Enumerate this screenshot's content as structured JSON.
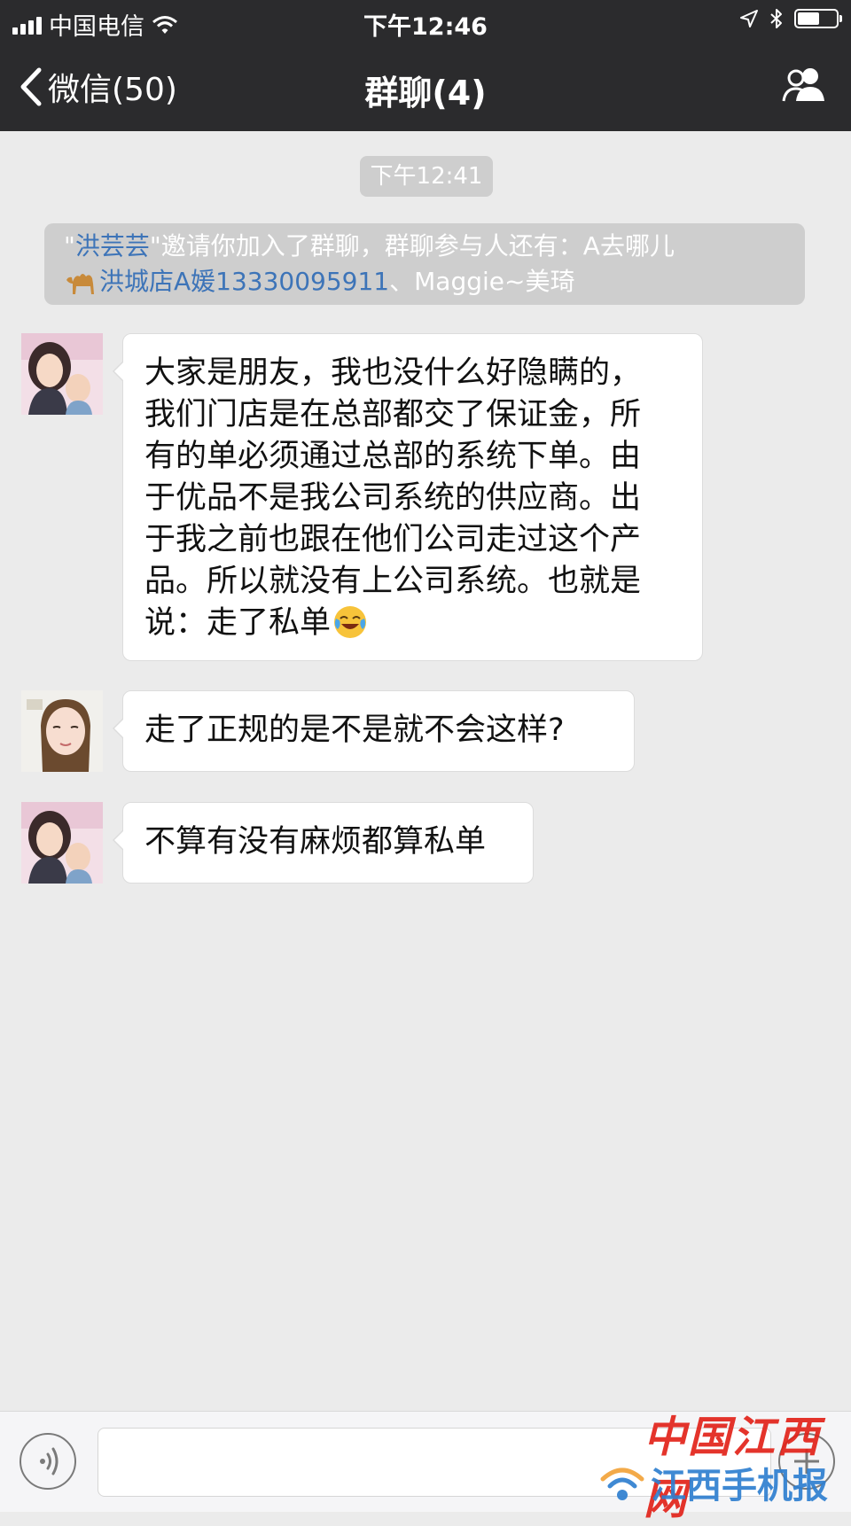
{
  "status_bar": {
    "carrier": "中国电信",
    "time": "下午12:46"
  },
  "nav": {
    "back_label": "微信(50)",
    "title": "群聊(4)"
  },
  "chat": {
    "timestamp": "下午12:41",
    "system_notice": {
      "quote_open": "\"",
      "inviter": "洪芸芸",
      "text_before_list": "\"邀请你加入了群聊，群聊参与人还有：A去哪儿",
      "participant_b": "洪城店A媛",
      "phone": "13330095911",
      "text_after": "、Maggie~美琦"
    },
    "messages": [
      {
        "lines": [
          "大家是朋友，我也没什么好隐瞒的，",
          "我们门店是在总部都交了保证金，所",
          "有的单必须通过总部的系统下单。由",
          "于优品不是我公司系统的供应商。出",
          "于我之前也跟在他们公司走过这个产",
          "品。所以就没有上公司系统。也就是",
          "说：走了私单"
        ],
        "emoji": "face-with-tears-of-joy"
      },
      {
        "lines": [
          "走了正规的是不是就不会这样?"
        ]
      },
      {
        "lines": [
          "不算有没有麻烦都算私单"
        ]
      }
    ]
  },
  "watermark": {
    "top": "中国江西网",
    "bottom": "江西手机报"
  },
  "colors": {
    "bar_bg": "#2b2b2d",
    "chat_bg": "#ebebeb",
    "link_blue": "#3d74b8",
    "watermark_red": "#e2231a",
    "watermark_blue": "#2f7fd0"
  }
}
